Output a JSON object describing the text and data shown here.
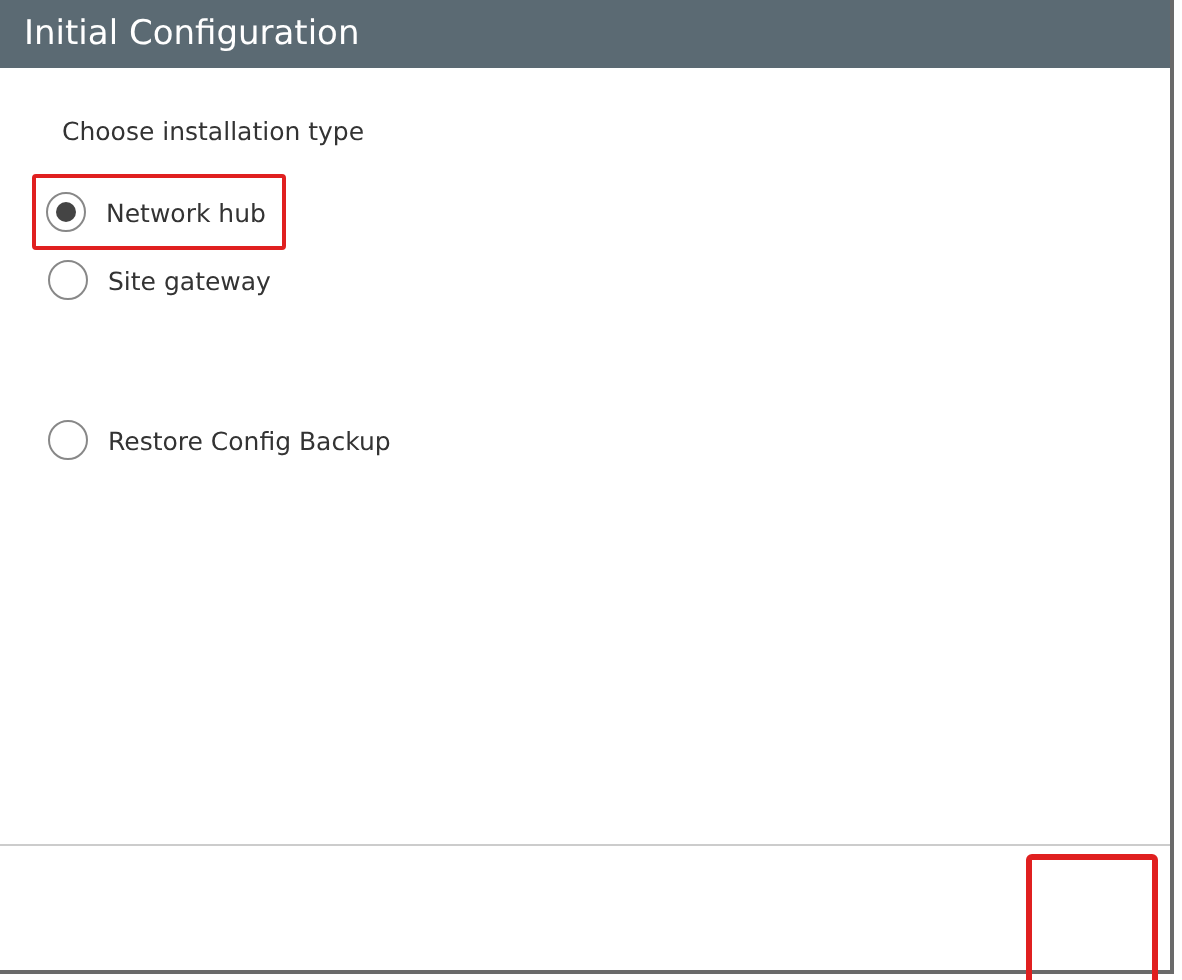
{
  "window": {
    "title": "Initial Configuration"
  },
  "prompt": "Choose installation type",
  "options": [
    {
      "label": "Network hub",
      "selected": true,
      "highlighted": true
    },
    {
      "label": "Site gateway",
      "selected": false,
      "highlighted": false
    }
  ],
  "extra_options": [
    {
      "label": "Restore Config Backup",
      "selected": false,
      "highlighted": false
    }
  ],
  "footer": {
    "highlighted": true
  }
}
